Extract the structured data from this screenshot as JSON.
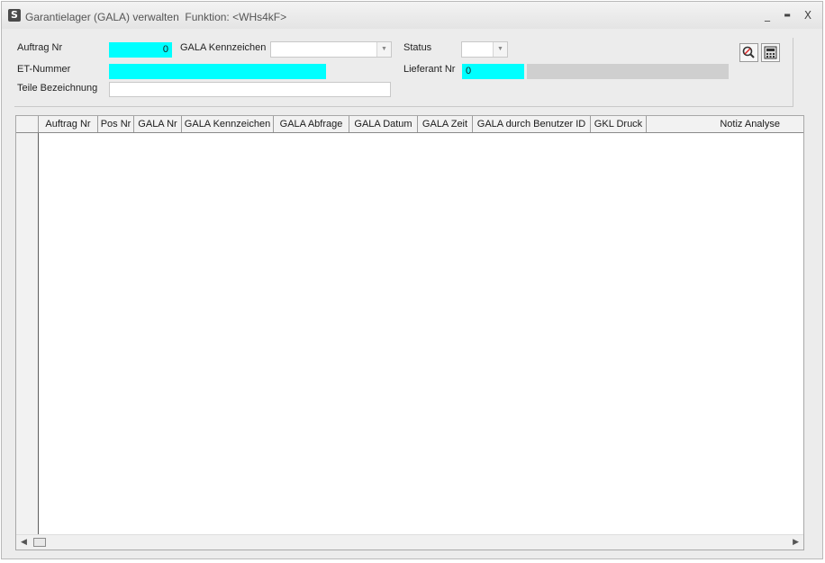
{
  "window": {
    "title": "Garantielager (GALA) verwalten  Funktion: <WHs4kF>",
    "app_icon": "app-logo-icon",
    "minimize": "_",
    "maximize": "▬",
    "close": "X"
  },
  "form": {
    "auftrag_nr": {
      "label": "Auftrag Nr",
      "value": "0"
    },
    "gala_kennzeichen": {
      "label": "GALA Kennzeichen",
      "value": ""
    },
    "status": {
      "label": "Status",
      "value": ""
    },
    "et_nummer": {
      "label": "ET-Nummer",
      "value": ""
    },
    "lieferant_nr": {
      "label": "Lieferant Nr",
      "value": "0",
      "name_value": ""
    },
    "teile_bezeichnung": {
      "label": "Teile Bezeichnung",
      "value": ""
    }
  },
  "toolbar": {
    "search_icon": "search-icon",
    "calculator_icon": "calculator-icon"
  },
  "grid": {
    "columns": [
      "Auftrag Nr",
      "Pos Nr",
      "GALA Nr",
      "GALA Kennzeichen",
      "GALA Abfrage",
      "GALA Datum",
      "GALA Zeit",
      "GALA durch Benutzer ID",
      "GKL Druck",
      "Notiz Analyse"
    ],
    "rows": []
  },
  "colors": {
    "required_field": "#00ffff",
    "window_bg": "#ececec"
  }
}
